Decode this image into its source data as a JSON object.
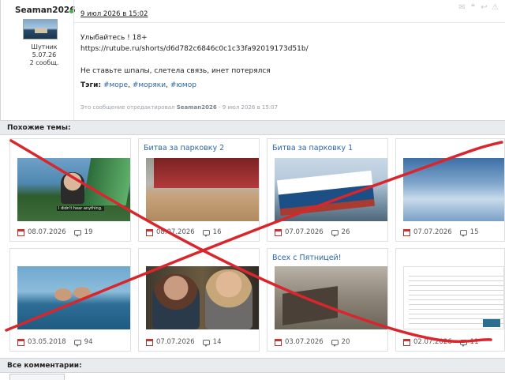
{
  "post": {
    "username": "Seaman2026",
    "user_rank": "Шутник",
    "user_joined": "5.07.26",
    "user_posts": "2 сообщ.",
    "date": "9 июл 2026 в 15:02",
    "text_line1": "Улыбайтесь ! 18+",
    "text_line2": "https://rutube.ru/shorts/d6d782c6846c0c1c33fa92019173d51b/",
    "text_line3": "Не ставьте шпалы, слетела связь, инет потерялся",
    "tags_label": "Тэги:",
    "tags": [
      "#море",
      "#моряки",
      "#юмор"
    ],
    "tag_separator": ",",
    "edit_prefix": "Это сообщение отредактировал",
    "edit_user": "Seaman2026",
    "edit_date": "- 9 июл 2026 в 15:07"
  },
  "similar": {
    "header": "Похожие темы:",
    "cards": [
      {
        "title": "",
        "date": "08.07.2026",
        "comments": "19",
        "thumb_caption": "I didn't hear anything."
      },
      {
        "title": "Битва за парковку 2",
        "date": "08.07.2026",
        "comments": "16"
      },
      {
        "title": "Битва за парковку 1",
        "date": "07.07.2026",
        "comments": "26"
      },
      {
        "title": "",
        "date": "07.07.2026",
        "comments": "15"
      },
      {
        "title": "",
        "date": "03.05.2018",
        "comments": "94"
      },
      {
        "title": "",
        "date": "07.07.2026",
        "comments": "14"
      },
      {
        "title": "Всех с Пятницей!",
        "date": "03.07.2026",
        "comments": "20"
      },
      {
        "title": "",
        "date": "02.07.2026",
        "comments": "11"
      }
    ]
  },
  "comments": {
    "header": "Все комментарии:"
  },
  "colors": {
    "link": "#2b66a8",
    "cross": "#d9262c",
    "section_bg": "#e9ecef",
    "online": "#4caf50"
  }
}
